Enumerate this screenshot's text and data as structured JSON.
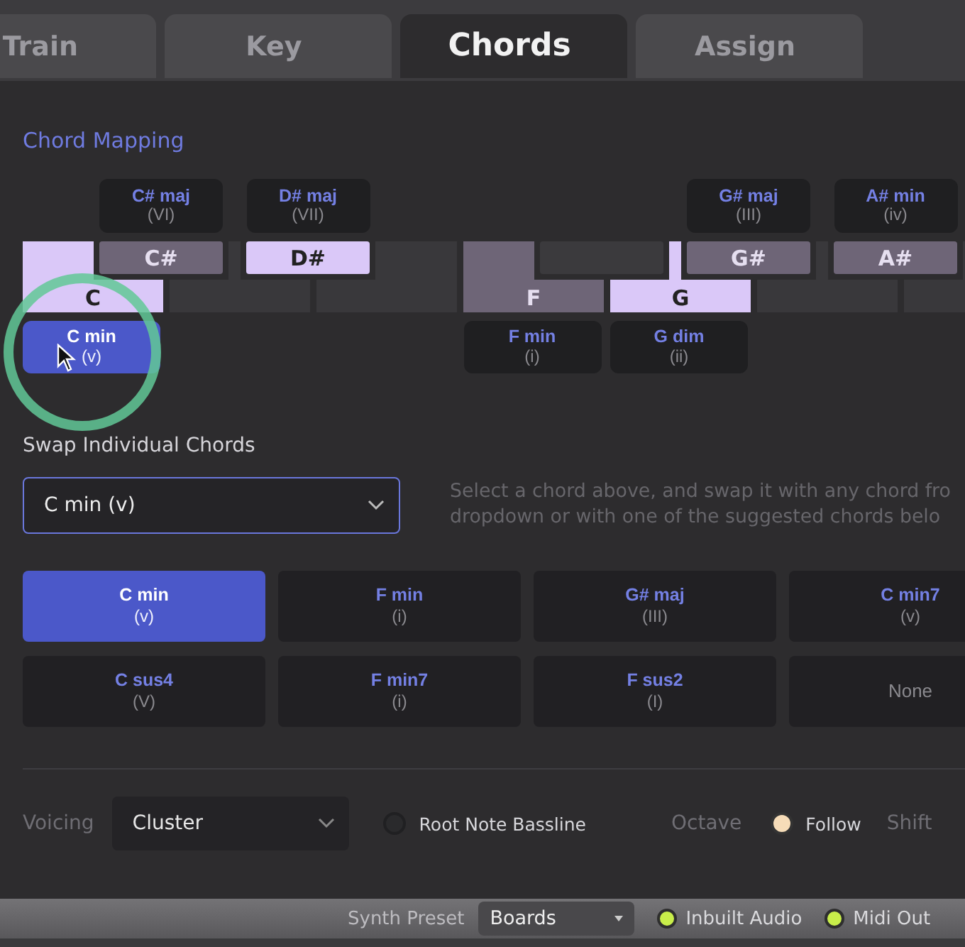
{
  "tabs": [
    {
      "label": "Train",
      "selected": false
    },
    {
      "label": "Key",
      "selected": false
    },
    {
      "label": "Chords",
      "selected": true
    },
    {
      "label": "Assign",
      "selected": false
    }
  ],
  "chord_mapping": {
    "title": "Chord Mapping",
    "keys": [
      {
        "kind": "white",
        "label": "C",
        "highlighted": true,
        "chord": {
          "name": "C min",
          "numeral": "(v)",
          "selected": true
        }
      },
      {
        "kind": "black",
        "label": "C#",
        "highlighted": false,
        "chord": {
          "name": "C# maj",
          "numeral": "(VI)",
          "selected": false
        }
      },
      {
        "kind": "white",
        "highlighted": false
      },
      {
        "kind": "black",
        "label": "D#",
        "highlighted": true,
        "chord": {
          "name": "D# maj",
          "numeral": "(VII)",
          "selected": false
        }
      },
      {
        "kind": "white",
        "highlighted": false
      },
      {
        "kind": "white",
        "label": "F",
        "highlighted": false,
        "chord": {
          "name": "F min",
          "numeral": "(i)",
          "selected": false
        }
      },
      {
        "kind": "black",
        "highlighted": false
      },
      {
        "kind": "white",
        "label": "G",
        "highlighted": true,
        "chord": {
          "name": "G dim",
          "numeral": "(ii)",
          "selected": false
        }
      },
      {
        "kind": "black",
        "label": "G#",
        "highlighted": false,
        "chord": {
          "name": "G# maj",
          "numeral": "(III)",
          "selected": false
        }
      },
      {
        "kind": "white",
        "highlighted": false
      },
      {
        "kind": "black",
        "label": "A#",
        "highlighted": false,
        "chord": {
          "name": "A# min",
          "numeral": "(iv)",
          "selected": false
        }
      },
      {
        "kind": "white",
        "highlighted": false
      }
    ]
  },
  "swap": {
    "title": "Swap Individual Chords",
    "dropdown_value": "C min (v)",
    "hint_lines": [
      "Select a chord above, and swap it with any chord fro",
      "dropdown or with one of the suggested chords belo"
    ],
    "suggestions": [
      {
        "name": "C min",
        "numeral": "(v)",
        "selected": true
      },
      {
        "name": "F min",
        "numeral": "(i)",
        "selected": false
      },
      {
        "name": "G# maj",
        "numeral": "(III)",
        "selected": false
      },
      {
        "name": "C min7",
        "numeral": "(v)",
        "selected": false
      },
      {
        "name": "C sus4",
        "numeral": "(V)",
        "selected": false
      },
      {
        "name": "F min7",
        "numeral": "(i)",
        "selected": false
      },
      {
        "name": "F sus2",
        "numeral": "(I)",
        "selected": false
      },
      {
        "none_label": "None",
        "selected": false
      }
    ]
  },
  "voicing": {
    "label": "Voicing",
    "value": "Cluster"
  },
  "root_note_bassline": {
    "label": "Root Note Bassline",
    "on": false
  },
  "octave": {
    "label": "Octave",
    "follow_label": "Follow",
    "follow_on": true,
    "shift_label": "Shift"
  },
  "status_bar": {
    "synth_preset_label": "Synth Preset",
    "synth_preset": "Boards",
    "outputs": [
      {
        "label": "Inbuilt Audio",
        "on": true
      },
      {
        "label": "Midi Out",
        "on": true
      }
    ]
  }
}
